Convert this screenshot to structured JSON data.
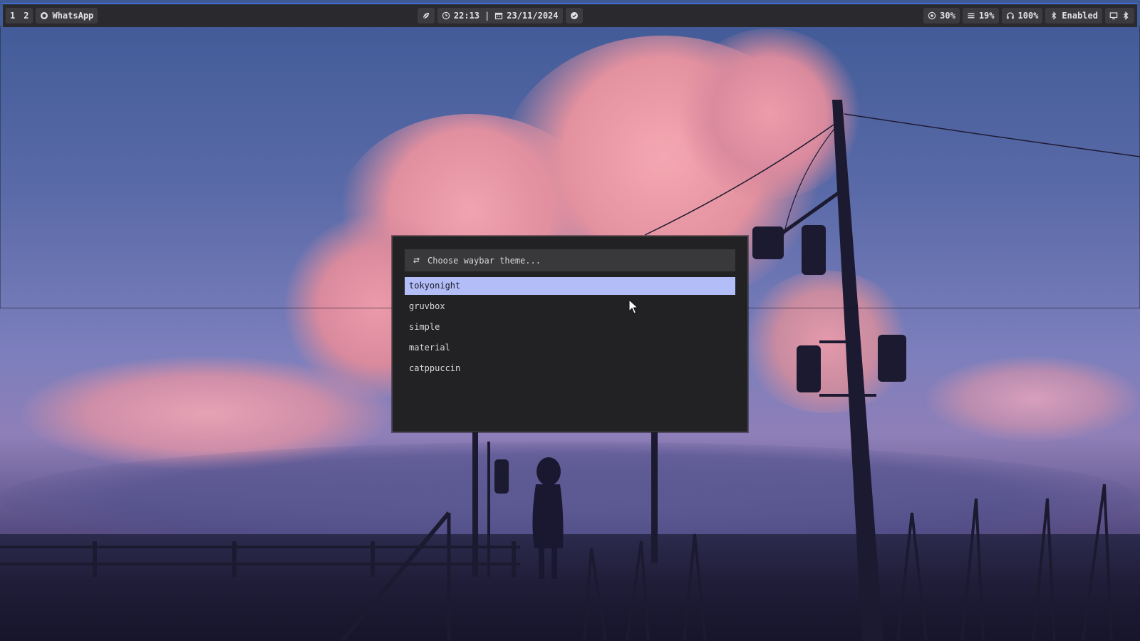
{
  "topbar": {
    "workspaces": [
      "1",
      "2"
    ],
    "active_window": {
      "icon": "whatsapp-icon",
      "label": "WhatsApp"
    },
    "center": {
      "weather_icon": "leaf-icon",
      "time": "22:13",
      "separator": "|",
      "date": "23/11/2024",
      "notification_icon": "check-circle-icon"
    },
    "right": {
      "cpu": "30%",
      "memory": "19%",
      "volume": "100%",
      "bluetooth_status": "Enabled"
    }
  },
  "dialog": {
    "prompt_icon": "swap-arrows-icon",
    "prompt": "Choose waybar theme...",
    "items": [
      "tokyonight",
      "gruvbox",
      "simple",
      "material",
      "catppuccin"
    ],
    "selected_index": 0
  },
  "colors": {
    "bar_bg": "#2a2a2e",
    "bar_accent": "#3f6fd4",
    "dialog_bg": "#222224",
    "selection": "#b3bdf7"
  }
}
